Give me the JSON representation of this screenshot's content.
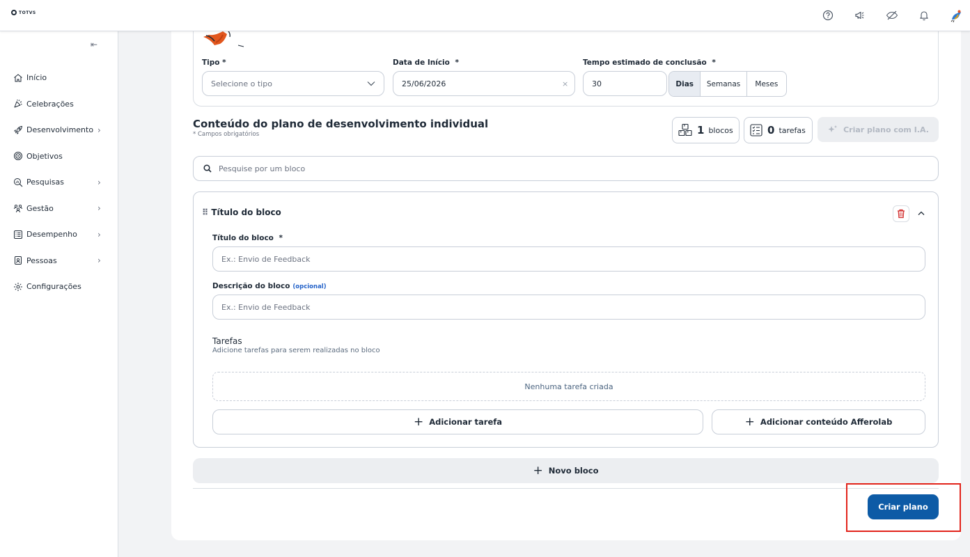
{
  "app": {
    "logo_text": "TOTVS"
  },
  "topbar": {
    "icons": [
      "help-icon",
      "megaphone-icon",
      "eye-off-icon",
      "bell-icon",
      "avatar"
    ]
  },
  "sidebar": {
    "items": [
      {
        "label": "Início",
        "icon": "home-icon",
        "has_children": false
      },
      {
        "label": "Celebrações",
        "icon": "party-icon",
        "has_children": false
      },
      {
        "label": "Desenvolvimento",
        "icon": "rocket-icon",
        "has_children": true
      },
      {
        "label": "Objetivos",
        "icon": "target-icon",
        "has_children": false
      },
      {
        "label": "Pesquisas",
        "icon": "search-chart-icon",
        "has_children": true
      },
      {
        "label": "Gestão",
        "icon": "people-icon",
        "has_children": true
      },
      {
        "label": "Desempenho",
        "icon": "list-icon",
        "has_children": true
      },
      {
        "label": "Pessoas",
        "icon": "badge-icon",
        "has_children": true
      },
      {
        "label": "Configurações",
        "icon": "gear-icon",
        "has_children": false
      }
    ]
  },
  "form": {
    "tipo": {
      "label": "Tipo *",
      "placeholder": "Selecione o tipo"
    },
    "data_inicio": {
      "label": "Data de Início",
      "required_mark": "*",
      "value": "25/06/2026",
      "clear": "×"
    },
    "tempo": {
      "label": "Tempo estimado de conclusão",
      "required_mark": "*",
      "value": "30"
    },
    "unidades": [
      {
        "label": "Dias",
        "active": true
      },
      {
        "label": "Semanas",
        "active": false
      },
      {
        "label": "Meses",
        "active": false
      }
    ]
  },
  "content": {
    "title": "Conteúdo do plano de desenvolvimento individual",
    "subtitle": "* Campos obrigatórios",
    "blocks_count": "1",
    "blocks_unit": "blocos",
    "tasks_count": "0",
    "tasks_unit": "tarefas",
    "ai_button": "Criar plano com I.A.",
    "search_placeholder": "Pesquise por um bloco"
  },
  "block": {
    "header_title": "Título do bloco",
    "title_label": "Título do bloco",
    "title_required": "*",
    "title_placeholder": "Ex.: Envio de Feedback",
    "desc_label": "Descrição do bloco",
    "desc_optional": "(opcional)",
    "desc_placeholder": "Ex.: Envio de Feedback",
    "tasks_title": "Tarefas",
    "tasks_subtitle": "Adicione tarefas para serem realizadas no bloco",
    "empty_tasks": "Nenhuma tarefa criada",
    "add_task": "Adicionar tarefa",
    "add_afferolab": "Adicionar conteúdo Afferolab"
  },
  "actions": {
    "new_block": "Novo bloco",
    "create_plan": "Criar plano"
  },
  "colors": {
    "primary": "#0d5ba6",
    "highlight": "#e2231a",
    "link": "#2563c9"
  }
}
